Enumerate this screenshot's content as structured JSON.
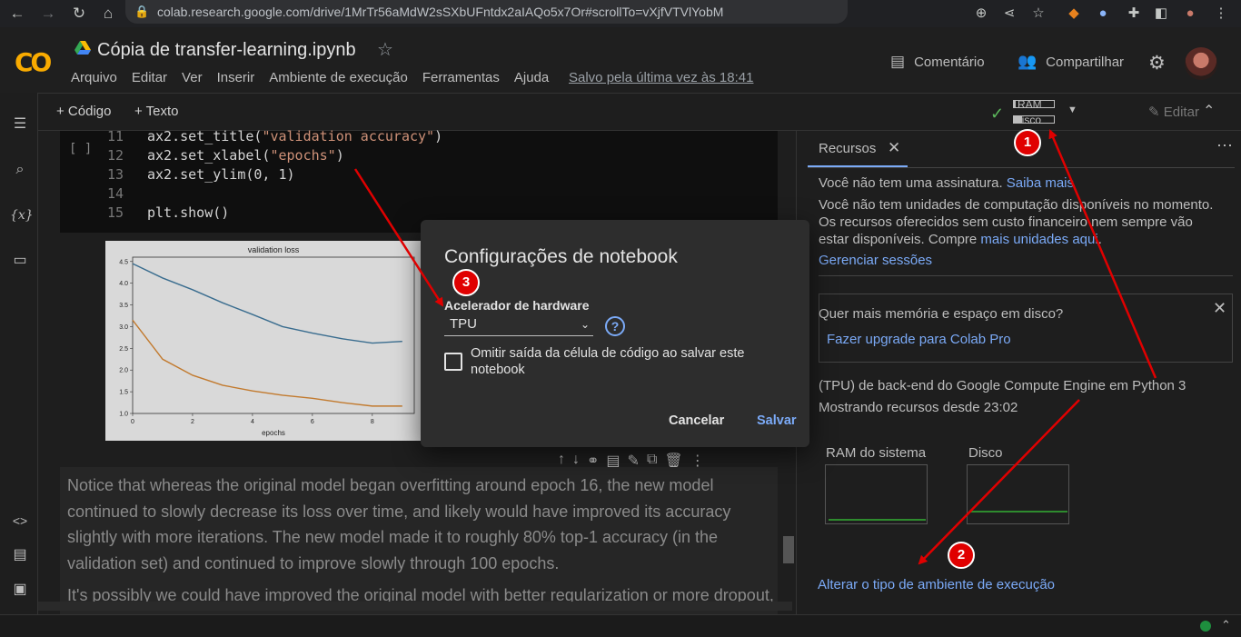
{
  "browser": {
    "url": "colab.research.google.com/drive/1MrTr56aMdW2sSXbUFntdx2aIAQo5x7Or#scrollTo=vXjfVTVlYobM"
  },
  "header": {
    "logo": "CO",
    "title": "Cópia de transfer-learning.ipynb",
    "menu": [
      "Arquivo",
      "Editar",
      "Ver",
      "Inserir",
      "Ambiente de execução",
      "Ferramentas",
      "Ajuda"
    ],
    "saved": "Salvo pela última vez às 18:41",
    "comment": "Comentário",
    "share": "Compartilhar"
  },
  "toolbar": {
    "add_code": "+ Código",
    "add_text": "+ Texto",
    "ram_label": "RAM",
    "disk_label": "Disco",
    "ram_usage": 0.05,
    "disk_usage": 0.2,
    "edit": "Editar"
  },
  "code_cell": {
    "run_indicator": "[ ]",
    "lines": [
      {
        "no": "11",
        "pre": "ax2.set_title(",
        "str": "\"validation accuracy\"",
        "post": ")"
      },
      {
        "no": "12",
        "pre": "ax2.set_xlabel(",
        "str": "\"epochs\"",
        "post": ")"
      },
      {
        "no": "13",
        "pre": "ax2.set_ylim(0, 1)",
        "str": "",
        "post": ""
      },
      {
        "no": "14",
        "pre": "",
        "str": "",
        "post": ""
      },
      {
        "no": "15",
        "pre": "plt.show()",
        "str": "",
        "post": ""
      }
    ]
  },
  "chart_data": {
    "type": "line",
    "title": "validation loss",
    "xlabel": "epochs",
    "ylabel": "",
    "x": [
      0,
      1,
      2,
      3,
      4,
      5,
      6,
      7,
      8,
      9
    ],
    "xticks": [
      "0",
      "2",
      "4",
      "6",
      "8"
    ],
    "yticks": [
      "1.0",
      "1.5",
      "2.0",
      "2.5",
      "3.0",
      "3.5",
      "4.0",
      "4.5"
    ],
    "ylim": [
      1.0,
      4.6
    ],
    "series": [
      {
        "values": [
          4.45,
          4.12,
          3.85,
          3.55,
          3.28,
          3.0,
          2.85,
          2.72,
          2.62,
          2.66
        ],
        "color": "#3a6d8f"
      },
      {
        "values": [
          3.15,
          2.25,
          1.88,
          1.65,
          1.52,
          1.42,
          1.35,
          1.25,
          1.17,
          1.17
        ],
        "color": "#c27a2e"
      }
    ]
  },
  "markdown": {
    "p1": "Notice that whereas the original model began overfitting around epoch 16, the new model continued to slowly decrease its loss over time, and likely would have improved its accuracy slightly with more iterations. The new model made it to roughly 80% top-1 accuracy (in the validation set) and continued to improve slowly through 100 epochs.",
    "p2": "It's possibly we could have improved the original model with better regularization or more dropout,"
  },
  "panel": {
    "tab": "Recursos",
    "sub_line1": "Você não tem uma assinatura.",
    "sub_link": "Saiba mais",
    "units_line1": "Você não tem unidades de computação disponíveis no momento.",
    "units_line2": "Os recursos oferecidos sem custo financeiro nem sempre vão",
    "units_line3": "estar disponíveis. Compre",
    "units_link": "mais unidades aqui",
    "manage": "Gerenciar sessões",
    "upgrade_q": "Quer mais memória e espaço em disco?",
    "upgrade_link": "Fazer upgrade para Colab Pro",
    "backend": "(TPU) de back-end do Google Compute Engine em Python 3",
    "since": "Mostrando recursos desde 23:02",
    "ram_chart": "RAM do sistema",
    "disk_chart": "Disco",
    "change_runtime": "Alterar o tipo de ambiente de execução"
  },
  "modal": {
    "title": "Configurações de notebook",
    "accel_label": "Acelerador de hardware",
    "accel_value": "TPU",
    "omit_label": "Omitir saída da célula de código ao salvar este notebook",
    "cancel": "Cancelar",
    "save": "Salvar"
  },
  "annotations": {
    "badge1": "1",
    "badge2": "2",
    "badge3": "3",
    "color": "#e00000"
  }
}
